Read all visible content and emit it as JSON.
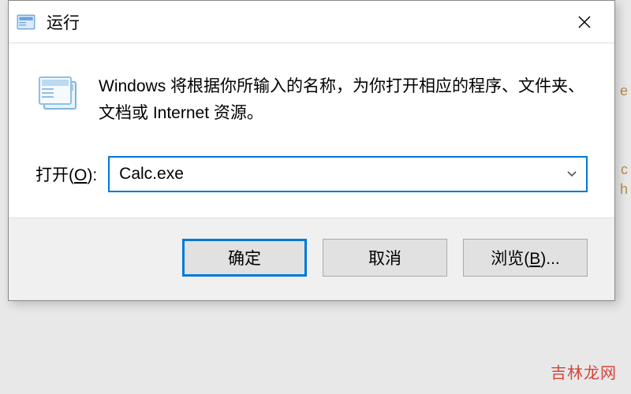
{
  "dialog": {
    "title": "运行",
    "description": "Windows 将根据你所输入的名称，为你打开相应的程序、文件夹、文档或 Internet 资源。",
    "open_label_prefix": "打开(",
    "open_label_hotkey": "O",
    "open_label_suffix": "):",
    "input_value": "Calc.exe",
    "buttons": {
      "ok": "确定",
      "cancel": "取消",
      "browse_prefix": "浏览(",
      "browse_hotkey": "B",
      "browse_suffix": ")..."
    }
  },
  "watermark": "吉林龙网",
  "colors": {
    "accent": "#0078d7",
    "button_bg": "#e1e1e1",
    "watermark": "#d6443a"
  }
}
